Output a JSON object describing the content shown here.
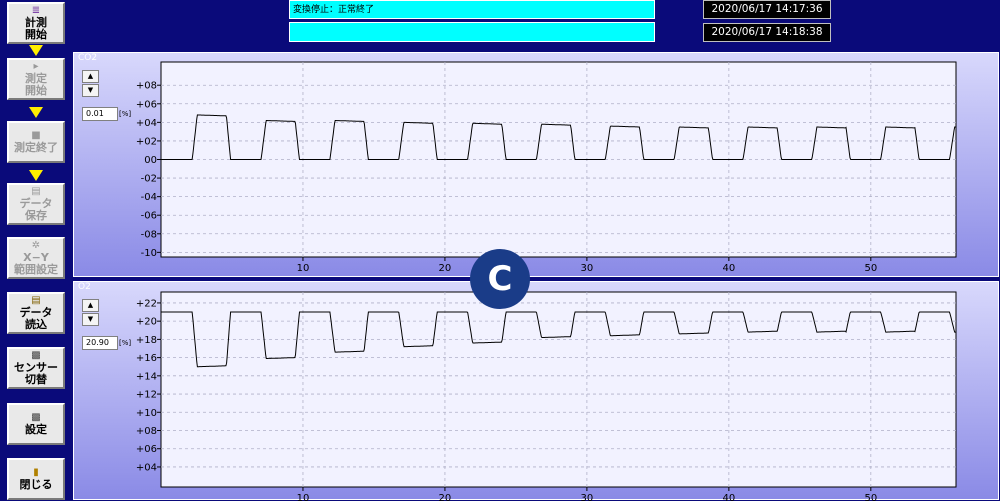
{
  "sidebar": {
    "buttons": [
      {
        "id": "start_measure",
        "label": "計測\n開始",
        "icon": "chart-icon",
        "enabled": true
      },
      {
        "id": "start_test",
        "label": "測定\n開始",
        "icon": "play-icon",
        "enabled": false
      },
      {
        "id": "end_test",
        "label": "測定終了",
        "icon": "stop-icon",
        "enabled": false
      },
      {
        "id": "save_data",
        "label": "データ\n保存",
        "icon": "save-icon",
        "enabled": false
      },
      {
        "id": "xy_range",
        "label": "X−Y\n範囲設定",
        "icon": "range-icon",
        "enabled": false
      },
      {
        "id": "load_data",
        "label": "データ\n読込",
        "icon": "file-icon",
        "enabled": true
      },
      {
        "id": "switch_sensor",
        "label": "センサー\n切替",
        "icon": "sensor-icon",
        "enabled": true
      },
      {
        "id": "settings",
        "label": "設定",
        "icon": "settings-icon",
        "enabled": true
      },
      {
        "id": "close",
        "label": "閉じる",
        "icon": "door-icon",
        "enabled": true
      }
    ]
  },
  "header": {
    "status_message": "変換停止：正常終了",
    "status_message_2": "",
    "start_time": "2020/06/17 14:17:36",
    "end_time": "2020/06/17 14:18:38"
  },
  "badge": {
    "label": "C"
  },
  "colors": {
    "background": "#0a0a7a",
    "status_box": "#00ffff",
    "plot_area": "#f2f2ff",
    "trace": "#000000",
    "arrow": "#ffee00",
    "badge": "#1a3c88"
  },
  "chart_data": [
    {
      "type": "line",
      "title": "CO2",
      "unit": "[%]",
      "scale_value": "0.01",
      "xlim": [
        0,
        56
      ],
      "x_ticks": [
        10,
        20,
        30,
        40,
        50
      ],
      "ylim": [
        -10.5,
        10.5
      ],
      "y_ticks": [
        "+08",
        "+06",
        "+04",
        "+02",
        "00",
        "-02",
        "-04",
        "-06",
        "-08",
        "-10"
      ],
      "y_tick_values": [
        8,
        6,
        4,
        2,
        0,
        -2,
        -4,
        -6,
        -8,
        -10
      ],
      "grid": true,
      "pattern": {
        "period": 4.85,
        "start": 2.2,
        "baseline": 0.0,
        "plateau": [
          4.8,
          4.2,
          4.2,
          4.0,
          3.9,
          3.8,
          3.6,
          3.5,
          3.5,
          3.5,
          3.5,
          3.5,
          3.5
        ]
      }
    },
    {
      "type": "line",
      "title": "O2",
      "unit": "[%]",
      "scale_value": "20.90",
      "xlim": [
        0,
        56
      ],
      "x_ticks": [
        10,
        20,
        30,
        40,
        50
      ],
      "ylim": [
        1.8,
        23.2
      ],
      "y_ticks": [
        "+22",
        "+20",
        "+18",
        "+16",
        "+14",
        "+12",
        "+10",
        "+08",
        "+06",
        "+04"
      ],
      "y_tick_values": [
        22,
        20,
        18,
        16,
        14,
        12,
        10,
        8,
        6,
        4
      ],
      "grid": true,
      "pattern": {
        "period": 4.85,
        "start": 2.2,
        "baseline": 21.0,
        "dip": [
          15.0,
          15.9,
          16.6,
          17.2,
          17.6,
          18.2,
          18.4,
          18.6,
          18.8,
          18.8,
          18.8,
          18.8,
          18.8
        ]
      }
    }
  ]
}
